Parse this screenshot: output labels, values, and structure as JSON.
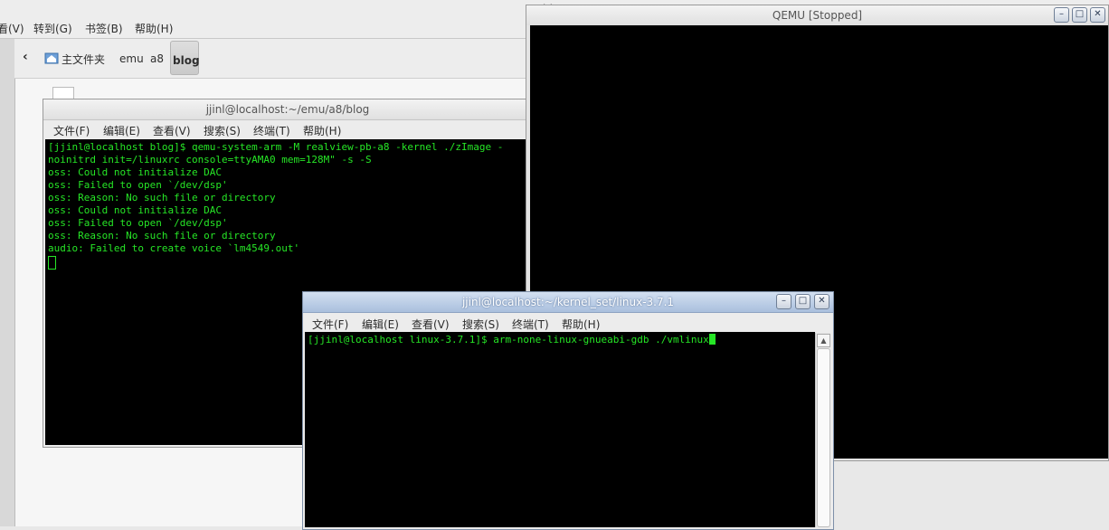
{
  "file_manager": {
    "title": "blog",
    "menu": [
      "看(V)",
      "转到(G)",
      "书签(B)",
      "帮助(H)"
    ],
    "back_icon": "chevron-left-icon",
    "home_icon": "home-folder-icon",
    "breadcrumbs": [
      "主文件夹",
      "emu",
      "a8",
      "blog"
    ]
  },
  "terminal_blog": {
    "title": "jjinl@localhost:~/emu/a8/blog",
    "menu": [
      "文件(F)",
      "编辑(E)",
      "查看(V)",
      "搜索(S)",
      "终端(T)",
      "帮助(H)"
    ],
    "lines": [
      "[jjinl@localhost blog]$ qemu-system-arm -M realview-pb-a8 -kernel ./zImage -",
      "noinitrd init=/linuxrc console=ttyAMA0 mem=128M\" -s -S",
      "oss: Could not initialize DAC",
      "oss: Failed to open `/dev/dsp'",
      "oss: Reason: No such file or directory",
      "oss: Could not initialize DAC",
      "oss: Failed to open `/dev/dsp'",
      "oss: Reason: No such file or directory",
      "audio: Failed to create voice `lm4549.out'"
    ]
  },
  "qemu": {
    "title": "QEMU [Stopped]"
  },
  "terminal_kernel": {
    "title": "jjinl@localhost:~/kernel_set/linux-3.7.1",
    "menu": [
      "文件(F)",
      "编辑(E)",
      "查看(V)",
      "搜索(S)",
      "终端(T)",
      "帮助(H)"
    ],
    "prompt": "[jjinl@localhost linux-3.7.1]$ arm-none-linux-gnueabi-gdb ./vmlinux"
  },
  "window_buttons": {
    "minimize": "minimize-icon",
    "maximize": "maximize-icon",
    "close": "close-icon"
  },
  "colors": {
    "terminal_text": "#26e626",
    "terminal_bg": "#000000",
    "active_titlebar": "#b8cbe6"
  }
}
